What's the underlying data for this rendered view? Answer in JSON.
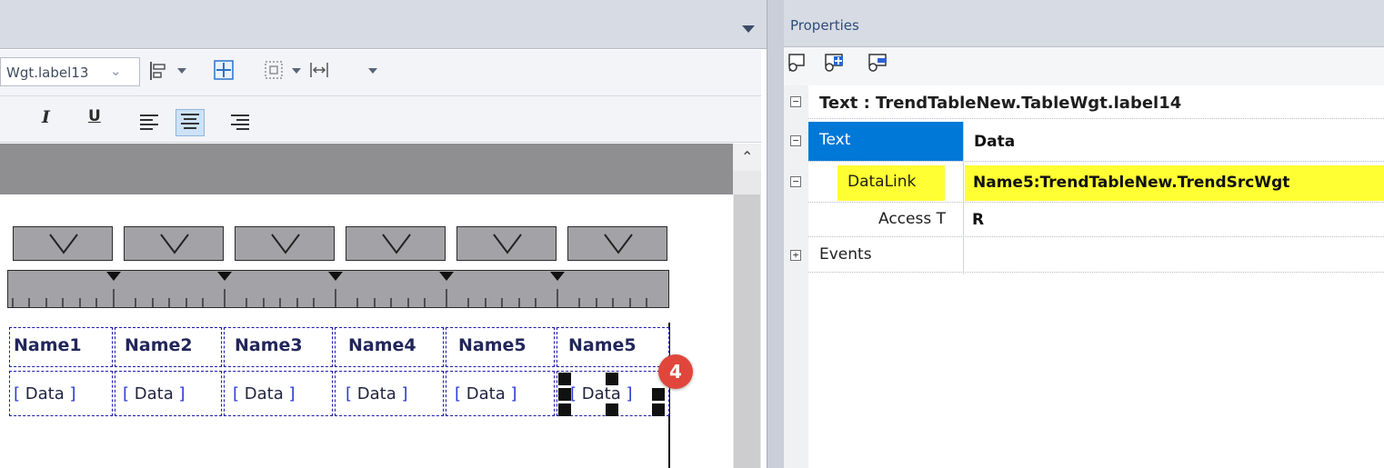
{
  "editor": {
    "widget_combo_value": "Wgt.label13",
    "format_toolbar": {
      "italic": "I",
      "underline": "U"
    }
  },
  "table": {
    "header_cells": [
      "Name1",
      "Name2",
      "Name3",
      "Name4",
      "Name5",
      "Name5"
    ],
    "data_cells": [
      "Data",
      "Data",
      "Data",
      "Data",
      "Data",
      "Data"
    ],
    "step_badge": "4"
  },
  "properties": {
    "title": "Properties",
    "section_label": "Text : TrendTableNew.TableWgt.label14",
    "rows": [
      {
        "name": "Text",
        "value": "Data"
      },
      {
        "name": "DataLink",
        "value": "Name5:TrendTableNew.TrendSrcWgt"
      },
      {
        "name": "Access T",
        "value": "R"
      },
      {
        "name": "Events",
        "value": ""
      }
    ]
  },
  "colors": {
    "selection_blue": "#0078d7",
    "highlight_yellow": "#ffff33",
    "badge_red": "#e0463c"
  }
}
